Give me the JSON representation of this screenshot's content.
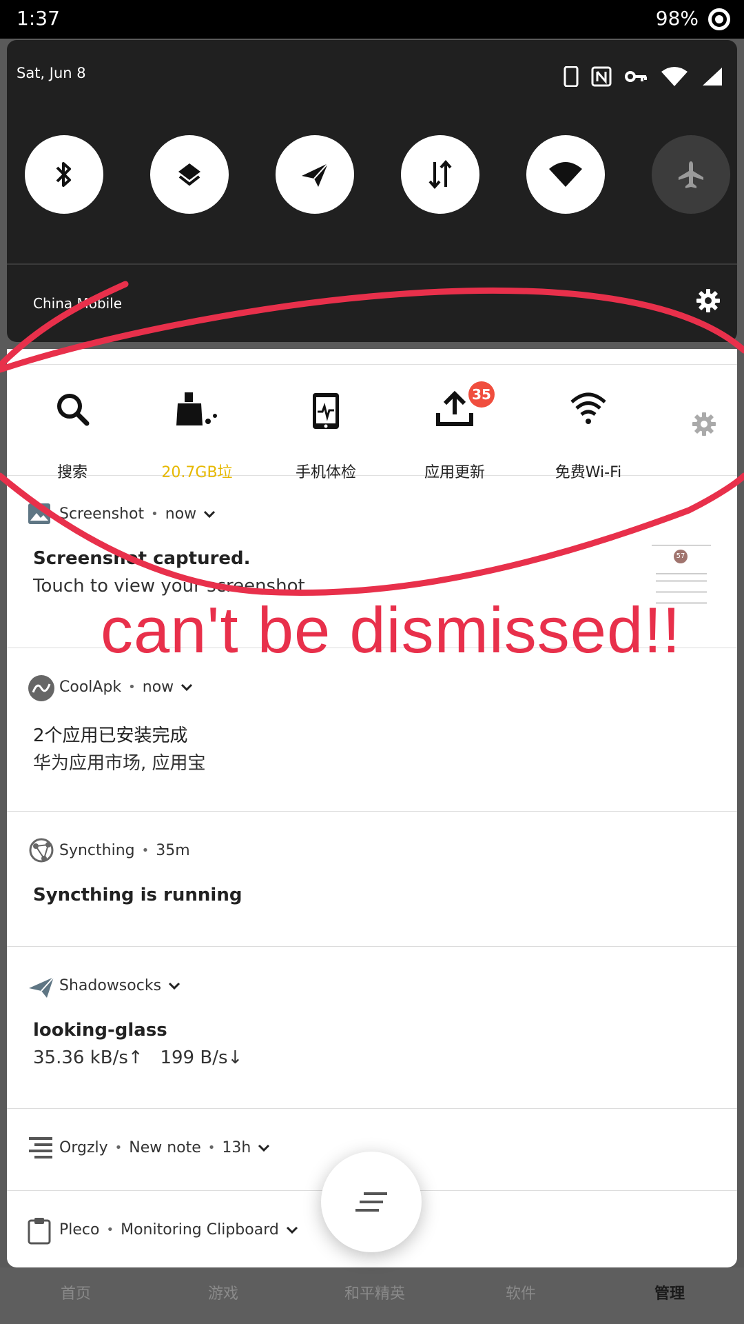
{
  "status_bar": {
    "time": "1:37",
    "battery": "98%"
  },
  "quick_settings": {
    "date": "Sat, Jun 8",
    "carrier": "China Mobile",
    "tiles": [
      {
        "name": "bluetooth",
        "icon": "bluetooth-icon",
        "state": "on"
      },
      {
        "name": "layers",
        "icon": "layers-icon",
        "state": "on"
      },
      {
        "name": "send",
        "icon": "paper-plane-icon",
        "state": "on"
      },
      {
        "name": "data",
        "icon": "data-transfer-icon",
        "state": "on"
      },
      {
        "name": "wifi",
        "icon": "wifi-icon",
        "state": "on"
      },
      {
        "name": "airplane",
        "icon": "airplane-icon",
        "state": "off"
      }
    ]
  },
  "widgets": [
    {
      "label": "搜索",
      "icon": "search-icon"
    },
    {
      "label": "20.7GB垃",
      "icon": "cleaner-icon"
    },
    {
      "label": "手机体检",
      "icon": "phone-check-icon"
    },
    {
      "label": "应用更新",
      "icon": "upload-icon",
      "badge": "35"
    },
    {
      "label": "免费Wi-Fi",
      "icon": "wifi-icon"
    }
  ],
  "notifications": [
    {
      "app": "Screenshot",
      "time": "now",
      "title": "Screenshot captured.",
      "text": "Touch to view your screenshot",
      "thumb_badge": "57"
    },
    {
      "app": "CoolApk",
      "time": "now",
      "title": "2个应用已安装完成",
      "text": "华为应用市场, 应用宝"
    },
    {
      "app": "Syncthing",
      "time": "35m",
      "title": "Syncthing is running"
    },
    {
      "app": "Shadowsocks",
      "title": "looking-glass",
      "text": "35.36 kB/s↑   199 B/s↓"
    },
    {
      "app": "Orgzly",
      "extra": "New note",
      "time": "13h"
    },
    {
      "app": "Pleco",
      "extra": "Monitoring Clipboard"
    }
  ],
  "bottom_nav": [
    "首页",
    "游戏",
    "和平精英",
    "软件",
    "管理"
  ],
  "annotation": "can't be dismissed!!",
  "colors": {
    "annotation": "#e8304b",
    "badge": "#f04e3e",
    "warning_label": "#e6b800"
  }
}
